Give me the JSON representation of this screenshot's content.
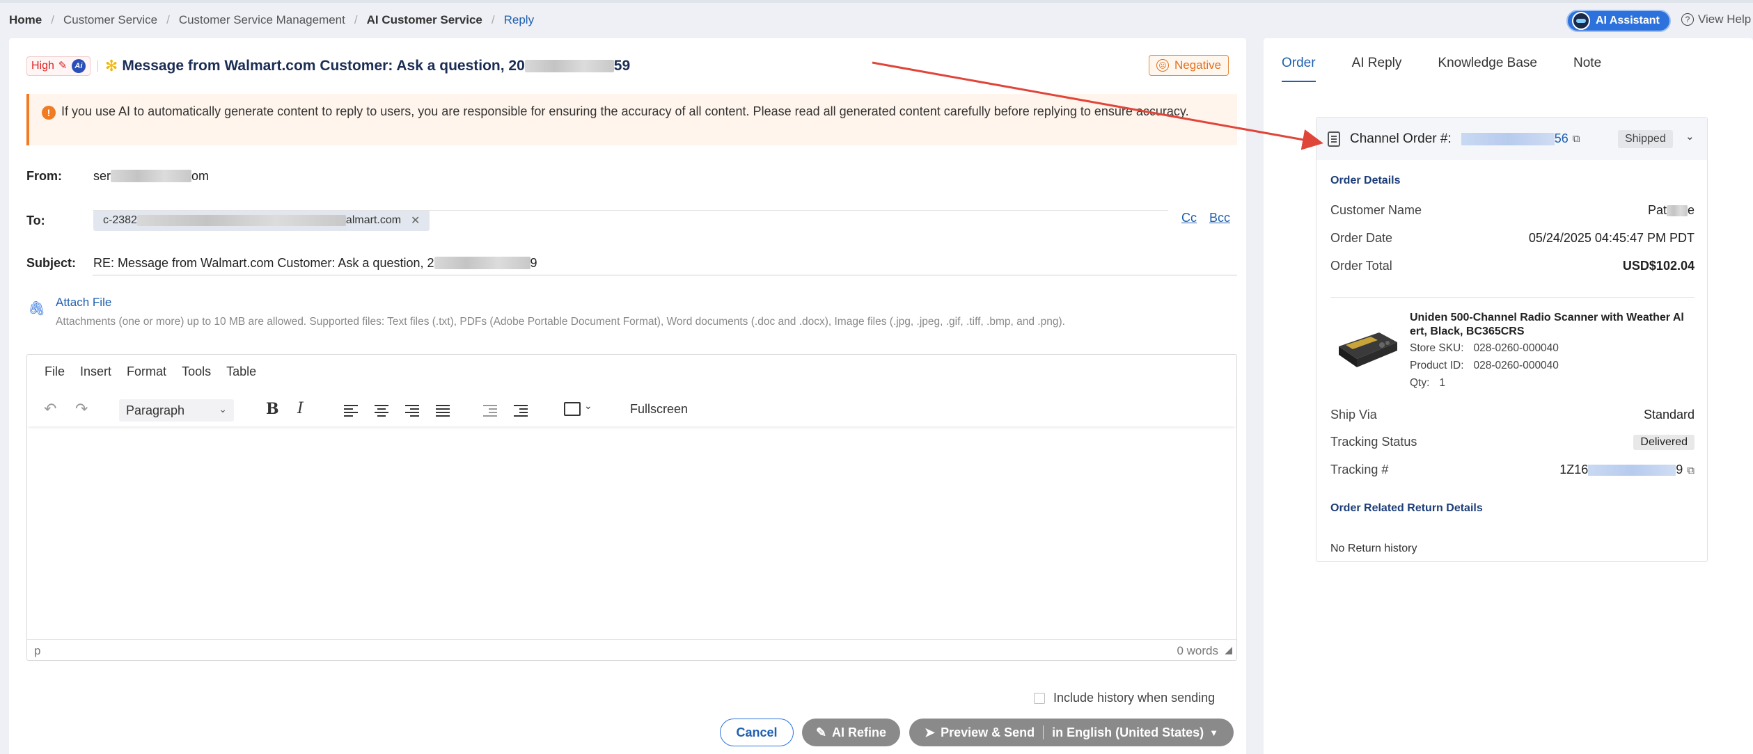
{
  "breadcrumb": {
    "items": [
      "Home",
      "Customer Service",
      "Customer Service Management",
      "AI Customer Service",
      "Reply"
    ]
  },
  "topbar": {
    "ai_assistant_label": "AI Assistant",
    "view_help_label": "View Help"
  },
  "message": {
    "priority": "High",
    "ai_badge": "Ai",
    "title_prefix": "Message from Walmart.com Customer: Ask a question, 20",
    "title_suffix": "59",
    "sentiment": "Negative",
    "warning": "If you use AI to automatically generate content to reply to users, you are responsible for ensuring the accuracy of all content. Please read all generated content carefully before replying to ensure accuracy."
  },
  "form": {
    "from_label": "From:",
    "from_prefix": "ser",
    "from_suffix": "om",
    "to_label": "To:",
    "to_prefix": "c-2382",
    "to_suffix": "almart.com",
    "cc_label": "Cc",
    "bcc_label": "Bcc",
    "subject_label": "Subject:",
    "subject_prefix": "RE: Message from Walmart.com Customer:  Ask a question, 2",
    "subject_suffix": "9",
    "attach_label": "Attach File",
    "attach_hint": "Attachments  (one or more)  up to 10 MB are allowed. Supported files: Text files (.txt), PDFs (Adobe Portable Document Format), Word documents (.doc and .docx), Image files (.jpg, .jpeg, .gif, .tiff, .bmp, and .png)."
  },
  "editor": {
    "menus": [
      "File",
      "Insert",
      "Format",
      "Tools",
      "Table"
    ],
    "block_format": "Paragraph",
    "fullscreen_label": "Fullscreen",
    "status_path": "p",
    "word_count": "0 words"
  },
  "footer": {
    "history_label": "Include history when sending",
    "cancel_label": "Cancel",
    "refine_label": "AI Refine",
    "send_label": "Preview & Send",
    "language_label": "in English (United States)"
  },
  "sidebar": {
    "tabs": [
      "Order",
      "AI Reply",
      "Knowledge Base",
      "Note"
    ],
    "active_tab": "Order",
    "order": {
      "channel_label": "Channel Order #:",
      "channel_suffix": "56",
      "status": "Shipped",
      "details_heading": "Order Details",
      "customer_name_label": "Customer Name",
      "customer_name_prefix": "Pat",
      "customer_name_suffix": "e",
      "order_date_label": "Order Date",
      "order_date": "05/24/2025 04:45:47 PM PDT",
      "order_total_label": "Order Total",
      "order_total": "USD$102.04",
      "product": {
        "name": "Uniden 500-Channel Radio Scanner with Weather Al ert, Black, BC365CRS",
        "store_sku_label": "Store SKU:",
        "store_sku": "028-0260-000040",
        "product_id_label": "Product ID:",
        "product_id": "028-0260-000040",
        "qty_label": "Qty:",
        "qty": "1"
      },
      "ship_via_label": "Ship Via",
      "ship_via": "Standard",
      "tracking_status_label": "Tracking Status",
      "tracking_status": "Delivered",
      "tracking_label": "Tracking #",
      "tracking_prefix": "1Z16",
      "tracking_suffix": "9",
      "return_heading": "Order Related Return Details",
      "return_text": "No Return history"
    }
  },
  "colors": {
    "accent": "#2d72dc",
    "link": "#1e5fb0",
    "danger": "#d22222",
    "warning": "#f07b22",
    "annotation_arrow": "#e0453a"
  }
}
